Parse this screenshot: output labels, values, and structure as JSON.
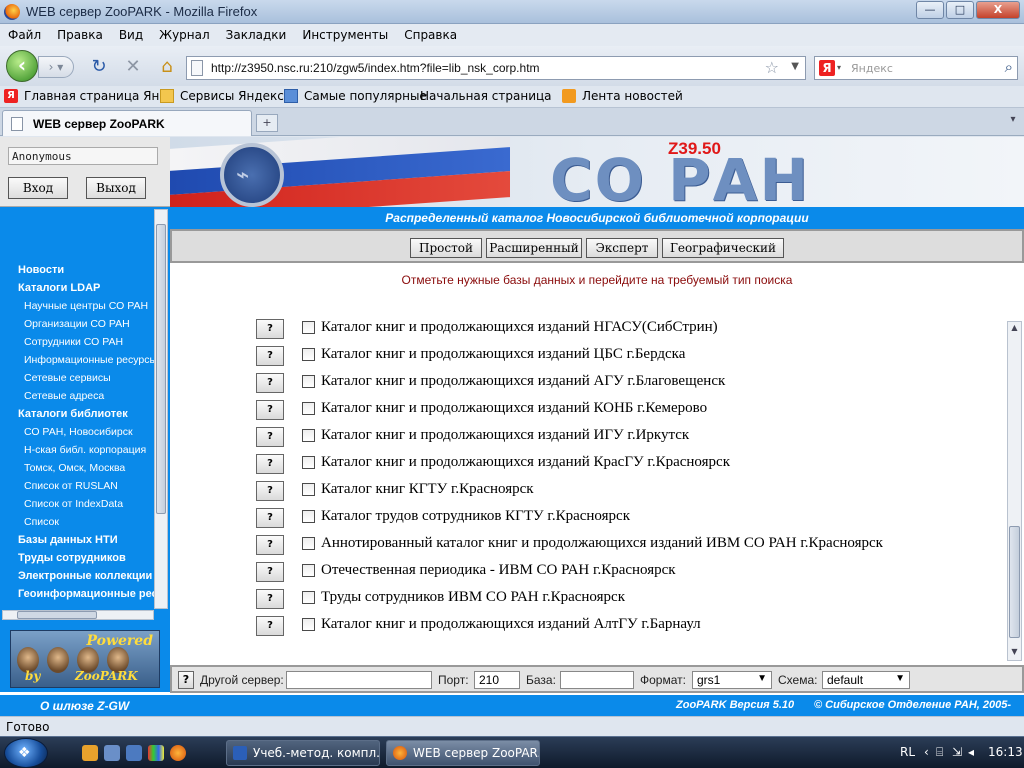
{
  "window": {
    "title": "WEB сервер ZooPARK - Mozilla Firefox",
    "buttons": {
      "minimize": "—",
      "maximize": "□",
      "close": "X"
    }
  },
  "menu": [
    "Файл",
    "Правка",
    "Вид",
    "Журнал",
    "Закладки",
    "Инструменты",
    "Справка"
  ],
  "nav": {
    "url": "http://z3950.nsc.ru:210/zgw5/index.htm?file=lib_nsk_corp.htm",
    "search_placeholder": "Яндекс",
    "search_engine_badge": "Я"
  },
  "bookmarks": [
    "Главная страница Ян...",
    "Сервисы Яндекса",
    "Самые популярные",
    "Начальная страница",
    "Лента новостей"
  ],
  "tabs": [
    {
      "label": "WEB сервер ZooPARK"
    }
  ],
  "tab_new": "+",
  "login": {
    "username": "Anonymous",
    "login_btn": "Вход",
    "logout_btn": "Выход"
  },
  "sidebar": {
    "items": [
      {
        "label": "Новости",
        "level": "top"
      },
      {
        "label": "Каталоги LDAP",
        "level": "top"
      },
      {
        "label": "Научные центры СО РАН",
        "level": "sub"
      },
      {
        "label": "Организации СО РАН",
        "level": "sub"
      },
      {
        "label": "Сотрудники СО РАН",
        "level": "sub"
      },
      {
        "label": "Информационные ресурсы",
        "level": "sub"
      },
      {
        "label": "Сетевые сервисы",
        "level": "sub"
      },
      {
        "label": "Сетевые адреса",
        "level": "sub"
      },
      {
        "label": "Каталоги библиотек",
        "level": "top"
      },
      {
        "label": "СО РАН,  Новосибирск",
        "level": "sub"
      },
      {
        "label": "Н-ская библ. корпорация",
        "level": "sub"
      },
      {
        "label": "Томск, Омск, Москва",
        "level": "sub"
      },
      {
        "label": "Список от RUSLAN",
        "level": "sub"
      },
      {
        "label": "Список от IndexData",
        "level": "sub"
      },
      {
        "label": "Список",
        "level": "sub"
      },
      {
        "label": "Базы данных НТИ",
        "level": "top"
      },
      {
        "label": "Труды сотрудников",
        "level": "top"
      },
      {
        "label": "Электронные коллекции",
        "level": "top"
      },
      {
        "label": "Геоинформационные ресурсы",
        "level": "top"
      }
    ],
    "powered_text": "Powered",
    "by_text": "by",
    "zoopark_text": "ZooPARK"
  },
  "banner": {
    "z3950": "Z39.50",
    "title": "СО РАН"
  },
  "catalog_title": "Распределенный каталог Новосибирской библиотечной корпорации",
  "search_tabs": [
    "Простой",
    "Расширенный",
    "Эксперт",
    "Географический"
  ],
  "hint": "Отметьте нужные базы данных и перейдите на требуемый тип поиска",
  "databases": [
    {
      "label": "Каталог книг и продолжающихся изданий НГАСУ(СибСтрин)",
      "checked": false
    },
    {
      "label": "Каталог книг и продолжающихся изданий ЦБС г.Бердска",
      "checked": false
    },
    {
      "label": "Каталог книг и продолжающихся изданий АГУ г.Благовещенск",
      "checked": false
    },
    {
      "label": "Каталог книг и продолжающихся изданий КОНБ г.Кемерово",
      "checked": false
    },
    {
      "label": "Каталог книг и продолжающихся изданий ИГУ г.Иркутск",
      "checked": false
    },
    {
      "label": "Каталог книг и продолжающихся изданий КрасГУ г.Красноярск",
      "checked": false
    },
    {
      "label": "Каталог книг КГТУ г.Красноярск",
      "checked": false
    },
    {
      "label": "Каталог трудов сотрудников КГТУ г.Красноярск",
      "checked": false
    },
    {
      "label": "Аннотированный каталог книг и продолжающихся изданий ИВМ СО РАН г.Красноярск",
      "checked": false
    },
    {
      "label": "Отечественная периодика - ИВМ СО РАН г.Красноярск",
      "checked": false
    },
    {
      "label": "Труды сотрудников ИВМ СО РАН г.Красноярск",
      "checked": false
    },
    {
      "label": "Каталог книг и продолжающихся изданий АлтГУ г.Барнаул",
      "checked": false
    }
  ],
  "db_help": "?",
  "server": {
    "help": "?",
    "other_server_label": "Другой сервер:",
    "other_server_value": "",
    "port_label": "Порт:",
    "port_value": "210",
    "base_label": "База:",
    "base_value": "",
    "format_label": "Формат:",
    "format_value": "grs1",
    "schema_label": "Схема:",
    "schema_value": "default"
  },
  "footer": {
    "left": "О шлюзе Z-GW",
    "middle": "ZooPARK  Версия 5.10",
    "right": "© Сибирское Отделение РАН, 2005-"
  },
  "status": "Готово",
  "taskbar": {
    "tasks": [
      {
        "label": "Учеб.-метод. компл...",
        "active": false
      },
      {
        "label": "WEB сервер ZooPAR...",
        "active": true
      }
    ],
    "lang": "RL",
    "time": "16:13"
  }
}
